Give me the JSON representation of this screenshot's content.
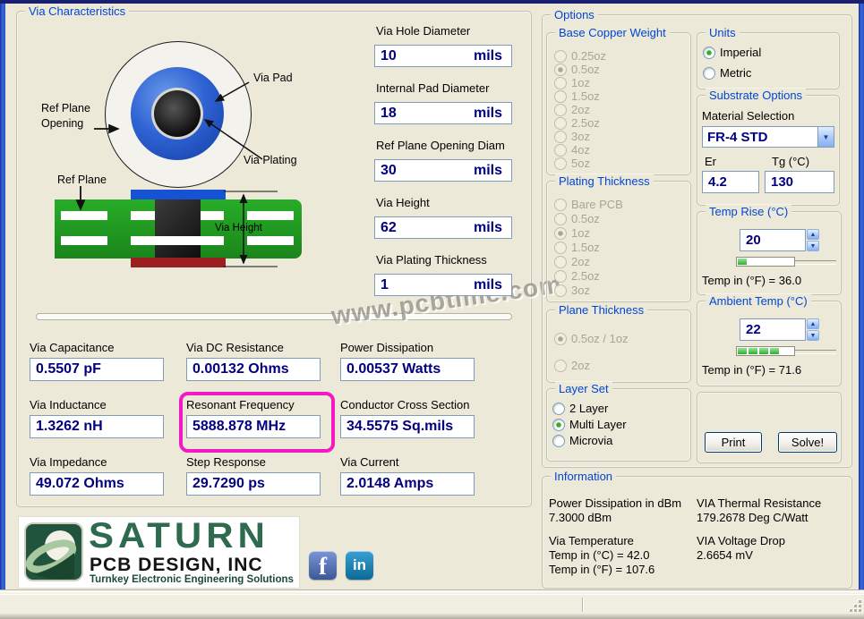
{
  "window": {
    "watermark": "www.pcbtime.com"
  },
  "via_characteristics": {
    "title": "Via Characteristics",
    "diagram": {
      "via_pad_label": "Via Pad",
      "ref_plane_opening_line1": "Ref Plane",
      "ref_plane_opening_line2": "Opening",
      "via_plating_label": "Via Plating",
      "ref_plane_label": "Ref Plane",
      "via_height_label": "Via Height"
    },
    "inputs": [
      {
        "label": "Via Hole Diameter",
        "value": "10",
        "unit": "mils"
      },
      {
        "label": "Internal Pad Diameter",
        "value": "18",
        "unit": "mils"
      },
      {
        "label": "Ref Plane Opening Diam",
        "value": "30",
        "unit": "mils"
      },
      {
        "label": "Via Height",
        "value": "62",
        "unit": "mils"
      },
      {
        "label": "Via Plating Thickness",
        "value": "1",
        "unit": "mils"
      }
    ],
    "outputs": [
      {
        "label": "Via Capacitance",
        "value": "0.5507 pF"
      },
      {
        "label": "Via DC Resistance",
        "value": "0.00132 Ohms"
      },
      {
        "label": "Power Dissipation",
        "value": "0.00537 Watts"
      },
      {
        "label": "Via Inductance",
        "value": "1.3262 nH"
      },
      {
        "label": "Resonant Frequency",
        "value": "5888.878 MHz"
      },
      {
        "label": "Conductor Cross Section",
        "value": "34.5575 Sq.mils"
      },
      {
        "label": "Via Impedance",
        "value": "49.072 Ohms"
      },
      {
        "label": "Step Response",
        "value": "29.7290 ps"
      },
      {
        "label": "Via Current",
        "value": "2.0148 Amps"
      }
    ]
  },
  "options": {
    "title": "Options",
    "base_copper_weight": {
      "title": "Base Copper Weight",
      "items": [
        "0.25oz",
        "0.5oz",
        "1oz",
        "1.5oz",
        "2oz",
        "2.5oz",
        "3oz",
        "4oz",
        "5oz"
      ],
      "selected": "0.5oz",
      "disabled": true
    },
    "plating_thickness": {
      "title": "Plating Thickness",
      "items": [
        "Bare PCB",
        "0.5oz",
        "1oz",
        "1.5oz",
        "2oz",
        "2.5oz",
        "3oz"
      ],
      "selected": "1oz",
      "disabled": true
    },
    "plane_thickness": {
      "title": "Plane Thickness",
      "items": [
        "0.5oz / 1oz",
        "2oz"
      ],
      "selected": "0.5oz / 1oz",
      "disabled": true
    },
    "layer_set": {
      "title": "Layer Set",
      "items": [
        "2 Layer",
        "Multi Layer",
        "Microvia"
      ],
      "selected": "Multi Layer",
      "disabled": false
    },
    "units": {
      "title": "Units",
      "items": [
        "Imperial",
        "Metric"
      ],
      "selected": "Imperial",
      "disabled": false
    },
    "substrate": {
      "title": "Substrate Options",
      "material_label": "Material Selection",
      "material_value": "FR-4 STD",
      "er_label": "Er",
      "er_value": "4.2",
      "tg_label": "Tg (°C)",
      "tg_value": "130"
    },
    "temp_rise": {
      "title": "Temp Rise (°C)",
      "value": "20",
      "segments": 1,
      "converted": "Temp in (°F) = 36.0"
    },
    "ambient_temp": {
      "title": "Ambient Temp (°C)",
      "value": "22",
      "segments": 4,
      "converted": "Temp in (°F) = 71.6"
    },
    "buttons": {
      "print": "Print",
      "solve": "Solve!"
    }
  },
  "information": {
    "title": "Information",
    "power_dissipation_dbm": {
      "label": "Power Dissipation in dBm",
      "value": "7.3000 dBm"
    },
    "thermal_resistance": {
      "label": "VIA Thermal Resistance",
      "value": "179.2678 Deg C/Watt"
    },
    "via_temperature": {
      "label": "Via Temperature",
      "value_c": "Temp in (°C) = 42.0",
      "value_f": "Temp in (°F) = 107.6"
    },
    "voltage_drop": {
      "label": "VIA Voltage Drop",
      "value": "2.6654 mV"
    }
  },
  "branding": {
    "logo_title": "SATURN",
    "logo_subtitle": "PCB DESIGN, INC",
    "logo_tagline": "Turnkey Electronic Engineering Solutions",
    "facebook_glyph": "f",
    "linkedin_glyph": "in"
  }
}
